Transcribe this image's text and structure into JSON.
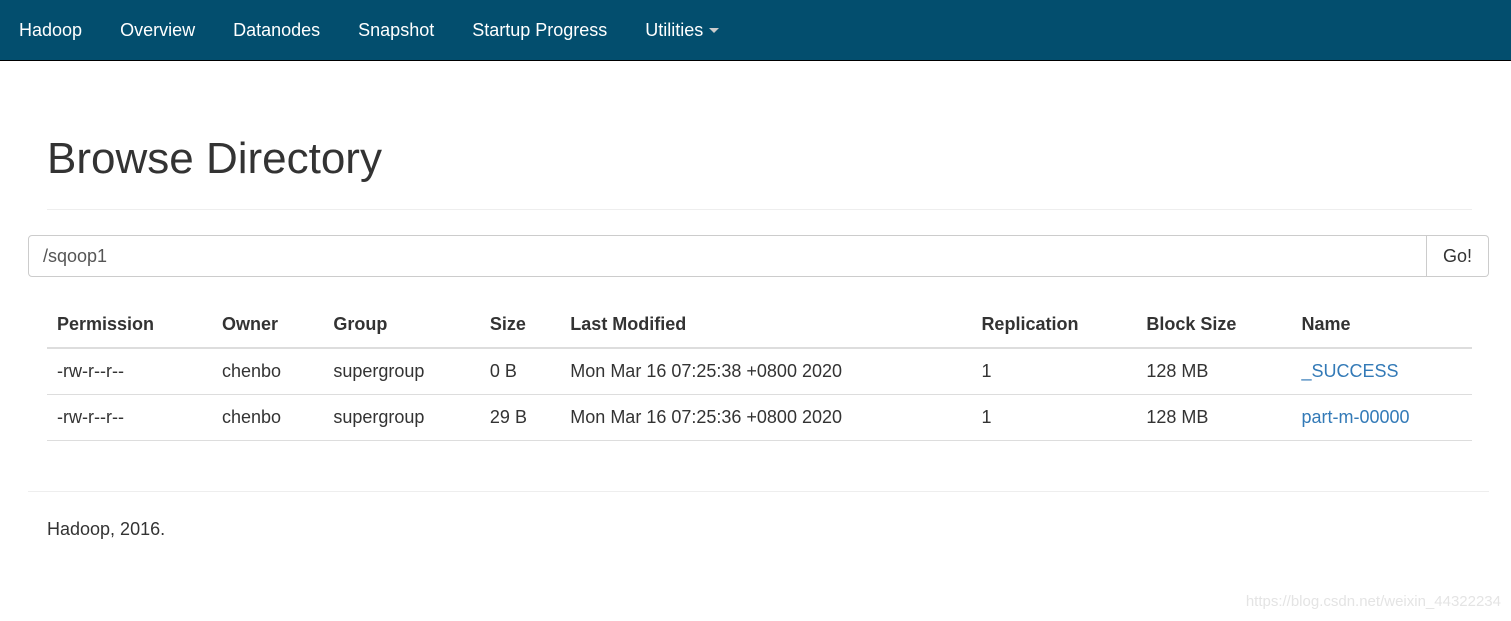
{
  "nav": {
    "brand": "Hadoop",
    "items": [
      "Overview",
      "Datanodes",
      "Snapshot",
      "Startup Progress",
      "Utilities"
    ]
  },
  "page_title": "Browse Directory",
  "path": {
    "value": "/sqoop1",
    "go_label": "Go!"
  },
  "table": {
    "headers": [
      "Permission",
      "Owner",
      "Group",
      "Size",
      "Last Modified",
      "Replication",
      "Block Size",
      "Name"
    ],
    "rows": [
      [
        "-rw-r--r--",
        "chenbo",
        "supergroup",
        "0 B",
        "Mon Mar 16 07:25:38 +0800 2020",
        "1",
        "128 MB",
        "_SUCCESS"
      ],
      [
        "-rw-r--r--",
        "chenbo",
        "supergroup",
        "29 B",
        "Mon Mar 16 07:25:36 +0800 2020",
        "1",
        "128 MB",
        "part-m-00000"
      ]
    ]
  },
  "footer": "Hadoop, 2016.",
  "watermark": "https://blog.csdn.net/weixin_44322234",
  "colors": {
    "navbar": "#034e6e",
    "link": "#337ab7"
  }
}
